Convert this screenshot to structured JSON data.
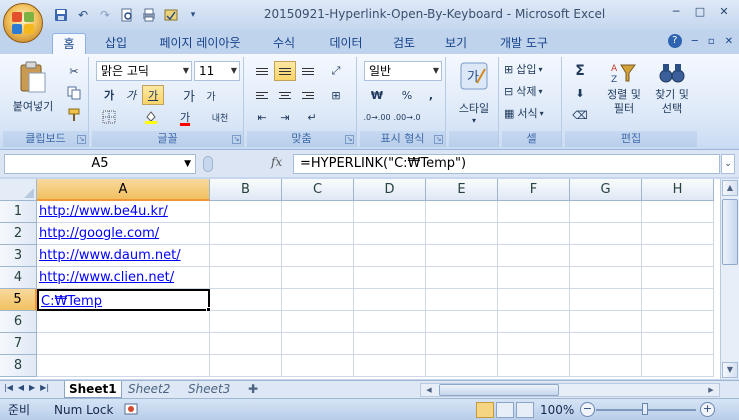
{
  "window": {
    "title": "20150921-Hyperlink-Open-By-Keyboard - Microsoft Excel",
    "controls": [
      "─",
      "□",
      "✕"
    ]
  },
  "qat": {
    "icons": [
      "save-icon",
      "undo-icon",
      "redo-icon",
      "print-preview-icon",
      "print-icon",
      "quick-access-customize-icon"
    ]
  },
  "tabs": [
    {
      "label": "홈",
      "active": true
    },
    {
      "label": "삽입"
    },
    {
      "label": "페이지 레이아웃"
    },
    {
      "label": "수식"
    },
    {
      "label": "데이터"
    },
    {
      "label": "검토"
    },
    {
      "label": "보기"
    },
    {
      "label": "개발 도구"
    }
  ],
  "ribbon": {
    "clipboard": {
      "label": "클립보드",
      "paste_label": "붙여넣기"
    },
    "font": {
      "label": "글꼴",
      "font_name": "맑은 고딕",
      "font_size": "11",
      "grow_label": "가",
      "shrink_label": "가",
      "bold_label": "가",
      "italic_label": "가",
      "underline_label": "가",
      "color_label": "가",
      "phonetic_label": "내천",
      "fill_color": "#ffff00",
      "font_color": "#ff0000"
    },
    "alignment": {
      "label": "맞춤"
    },
    "number": {
      "label": "표시 형식",
      "format": "일반",
      "currency": "₩",
      "percent": "%",
      "comma": ","
    },
    "styles": {
      "label": "스타일"
    },
    "cells": {
      "label": "셀",
      "insert": "삽입",
      "delete": "삭제",
      "format": "서식"
    },
    "editing": {
      "label": "편집",
      "sort_filter": "정렬 및 필터",
      "find_select": "찾기 및 선택",
      "sum": "Σ"
    }
  },
  "formula_bar": {
    "name_box": "A5",
    "fx": "fx",
    "formula": "=HYPERLINK(\"C:₩Temp\")"
  },
  "columns": [
    "A",
    "B",
    "C",
    "D",
    "E",
    "F",
    "G",
    "H"
  ],
  "selected_column": "A",
  "rows": [
    {
      "num": "1",
      "a": "http://www.be4u.kr/",
      "link": true
    },
    {
      "num": "2",
      "a": "http://google.com/",
      "link": true
    },
    {
      "num": "3",
      "a": "http://www.daum.net/",
      "link": true
    },
    {
      "num": "4",
      "a": "http://www.clien.net/",
      "link": true
    },
    {
      "num": "5",
      "a": "C:₩Temp",
      "link": true,
      "active": true
    },
    {
      "num": "6",
      "a": ""
    },
    {
      "num": "7",
      "a": ""
    },
    {
      "num": "8",
      "a": ""
    }
  ],
  "sheets": [
    {
      "label": "Sheet1",
      "active": true
    },
    {
      "label": "Sheet2"
    },
    {
      "label": "Sheet3"
    }
  ],
  "status": {
    "mode": "준비",
    "numlock": "Num Lock",
    "zoom": "100%"
  }
}
